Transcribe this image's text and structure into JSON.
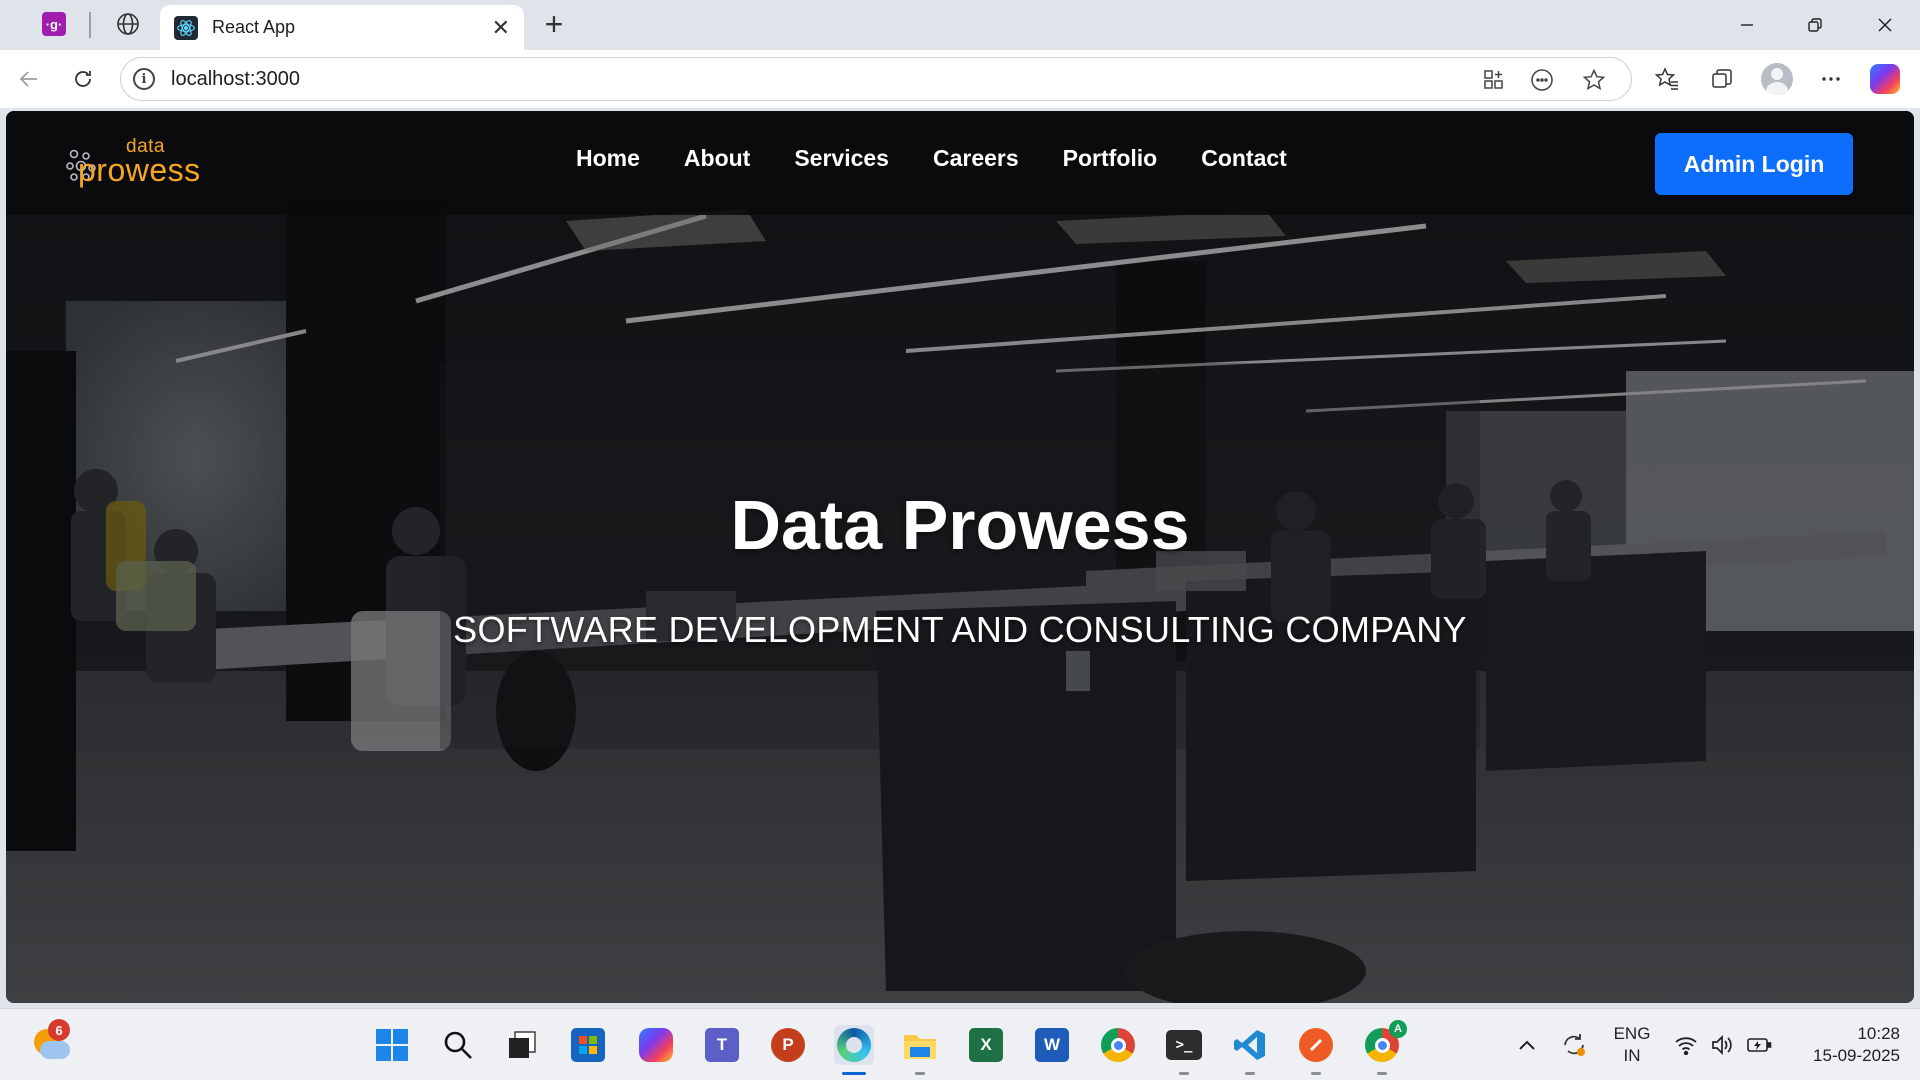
{
  "browser": {
    "active_tab_title": "React App",
    "url": "localhost:3000"
  },
  "site": {
    "logo_top": "data",
    "logo_bottom": "prowess",
    "nav": [
      "Home",
      "About",
      "Services",
      "Careers",
      "Portfolio",
      "Contact"
    ],
    "admin_button": "Admin Login",
    "hero_title": "Data Prowess",
    "hero_subtitle": "SOFTWARE DEVELOPMENT AND CONSULTING COMPANY"
  },
  "taskbar": {
    "weather_badge": "6",
    "lang_top": "ENG",
    "lang_bottom": "IN",
    "time": "10:28",
    "date": "15-09-2025",
    "chrome_badge": "A"
  },
  "colors": {
    "logo_orange": "#f5a623",
    "admin_blue": "#0d6efd",
    "navbar_bg": "#0a0a0c"
  }
}
